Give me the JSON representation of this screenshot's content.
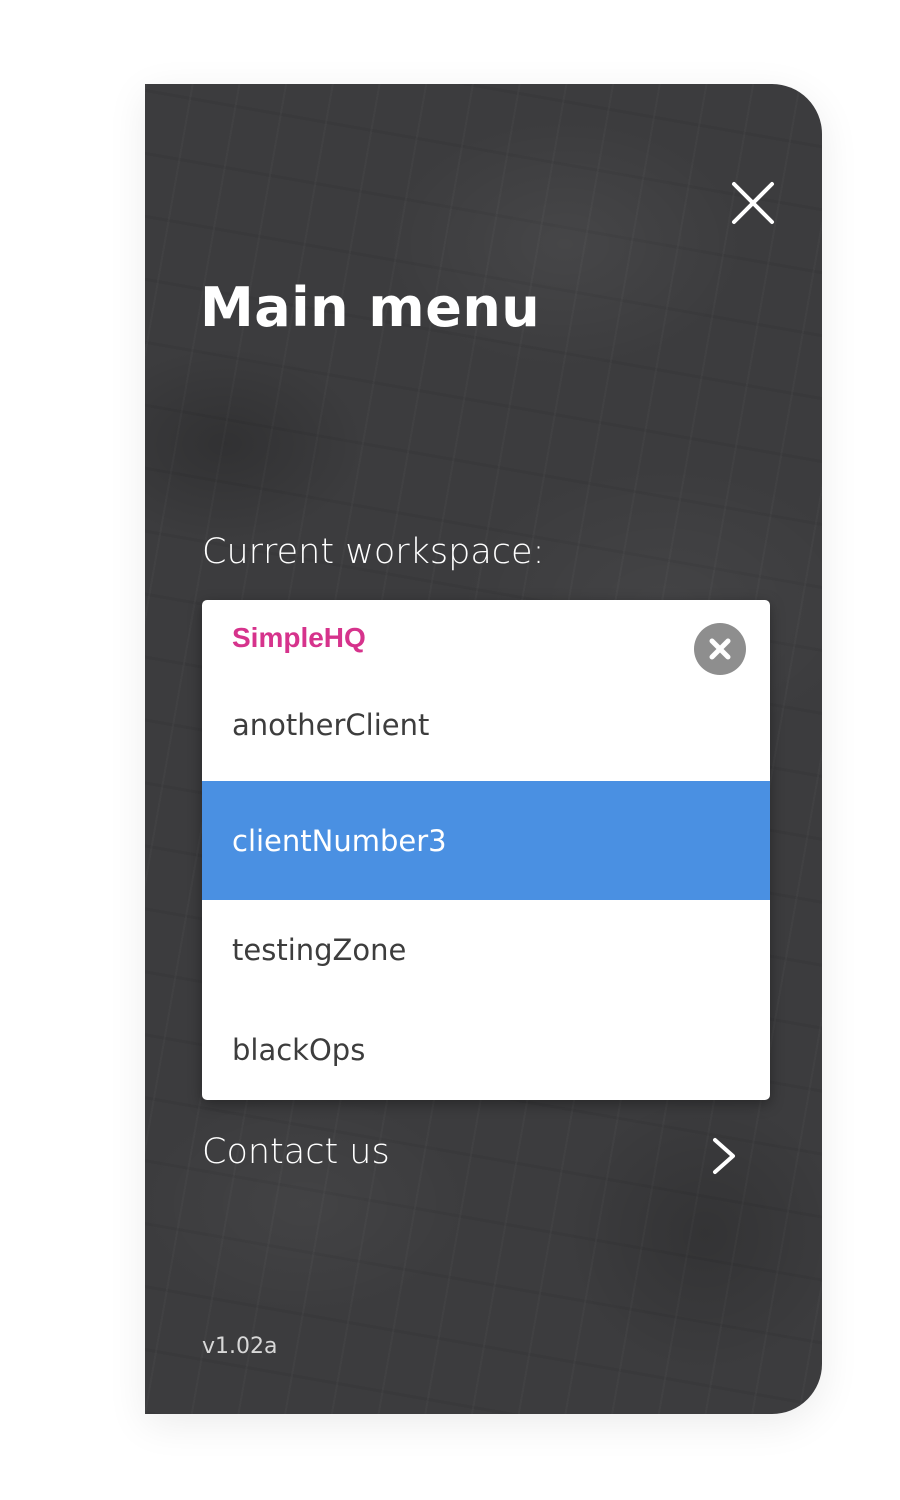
{
  "menu": {
    "title": "Main menu",
    "close_icon": "close-icon"
  },
  "workspace": {
    "label": "Current workspace:",
    "selected": "SimpleHQ",
    "selected_color": "#d6338c",
    "clear_icon": "clear-circle-icon",
    "options": [
      {
        "label": "anotherClient",
        "highlighted": false
      },
      {
        "label": "clientNumber3",
        "highlighted": true
      },
      {
        "label": "testingZone",
        "highlighted": false
      },
      {
        "label": "blackOps",
        "highlighted": false
      }
    ],
    "highlight_color": "#4a90e2"
  },
  "contact": {
    "label": "Contact us",
    "icon": "chevron-right-icon"
  },
  "version": "v1.02a",
  "colors": {
    "panel_background": "#3c3c3e",
    "text_on_dark": "#ffffff"
  }
}
